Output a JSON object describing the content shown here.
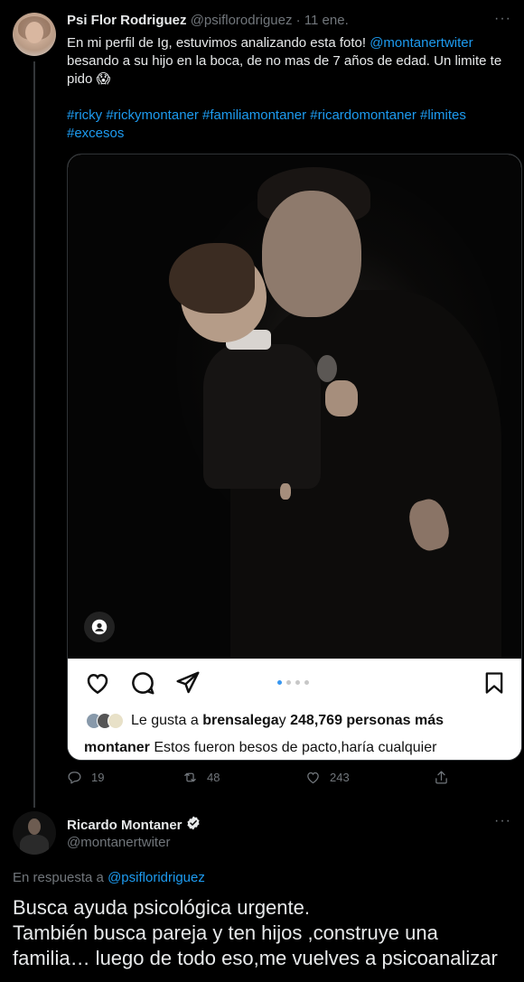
{
  "tweet1": {
    "name": "Psi Flor Rodriguez",
    "handle": "@psiflorodriguez",
    "separator": "·",
    "date": "11 ene.",
    "more": "···",
    "text_before": "En mi perfil de Ig, estuvimos analizando esta foto! ",
    "mention": "@montanertwiter",
    "text_after": " besando a su hijo en la boca, de no mas de 7 años de edad. Un limite te pido 😱",
    "hashtags": "#ricky #rickymontaner #familiamontaner #ricardomontaner #limites #excesos",
    "embed": {
      "likes_prefix": "Le gusta a ",
      "likes_user": "brensalega",
      "likes_mid": " y ",
      "likes_count": "248,769 personas más",
      "caption_user": "montaner",
      "caption_text": " Estos fueron besos de pacto,haría cualquier"
    },
    "actions": {
      "replies": "19",
      "retweets": "48",
      "likes": "243"
    }
  },
  "tweet2": {
    "name": "Ricardo Montaner",
    "handle": "@montanertwiter",
    "more": "···",
    "reply_prefix": "En respuesta a ",
    "reply_handle": "@psifloridriguez",
    "text": "Busca ayuda psicológica urgente.\nTambién busca pareja y ten hijos ,construye una familia… luego de todo eso,me vuelves a psicoanalizar"
  },
  "colors": {
    "accent": "#1d9bf0",
    "muted": "#71767b",
    "background": "#000000"
  }
}
